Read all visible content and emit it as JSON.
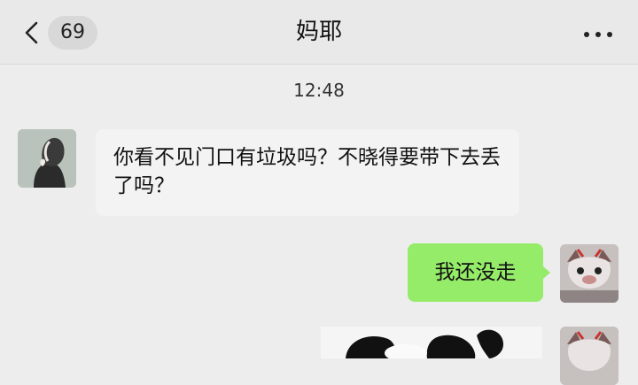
{
  "header": {
    "back_count": "69",
    "title": "妈耶",
    "back_icon": "chevron-left-icon",
    "more_icon": "more-dots-icon"
  },
  "chat": {
    "timestamp": "12:48",
    "messages": [
      {
        "side": "left",
        "text": "你看不见门口有垃圾吗？不晓得要带下去丢了吗？"
      },
      {
        "side": "right",
        "text": "我还没走"
      },
      {
        "side": "right",
        "type": "sticker"
      }
    ]
  },
  "colors": {
    "accent": "#95ec69",
    "background": "#ededed"
  }
}
